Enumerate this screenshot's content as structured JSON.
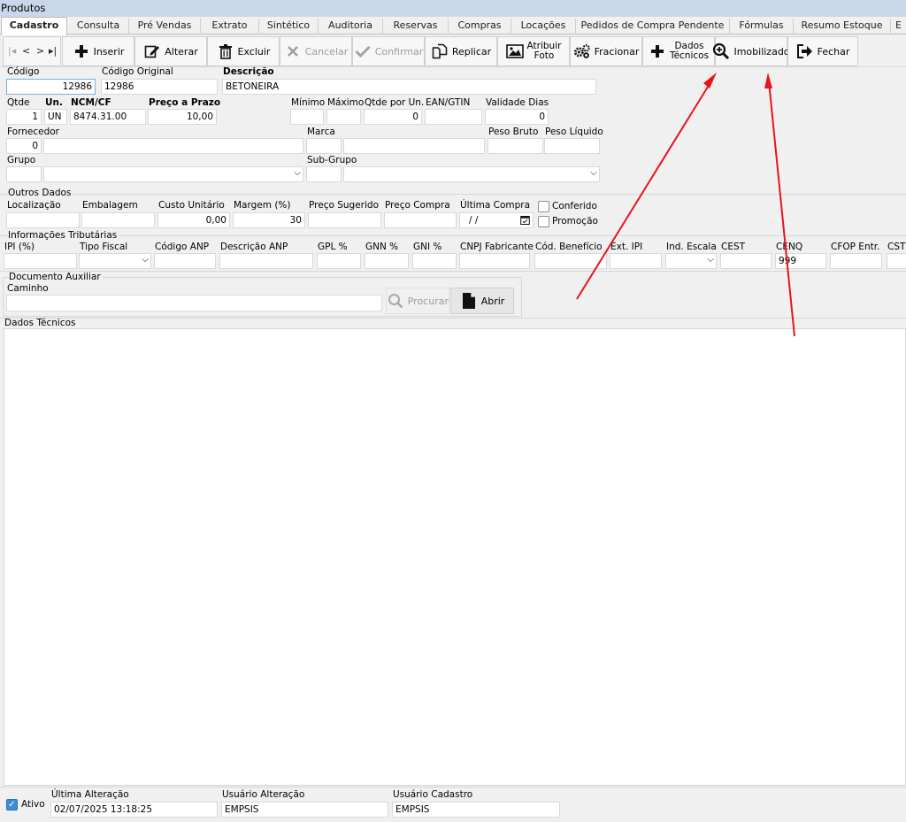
{
  "window": {
    "title": "Produtos"
  },
  "tabs": [
    "Cadastro",
    "Consulta",
    "Pré Vendas",
    "Extrato",
    "Sintético",
    "Auditoria",
    "Reservas",
    "Compras",
    "Locações",
    "Pedidos de Compra Pendente",
    "Fórmulas",
    "Resumo Estoque",
    "E"
  ],
  "toolbar": {
    "insert": "Inserir",
    "alter": "Alterar",
    "delete": "Excluir",
    "cancel": "Cancelar",
    "confirm": "Confirmar",
    "replicate": "Replicar",
    "photo_l1": "Atribuir",
    "photo_l2": "Foto",
    "split": "Fracionar",
    "tech_l1": "Dados",
    "tech_l2": "Técnicos",
    "fixed_asset": "Imobilizado",
    "close": "Fechar"
  },
  "form": {
    "codigo": {
      "label": "Código",
      "value": "12986"
    },
    "codigo_original": {
      "label": "Código Original",
      "value": "12986"
    },
    "descricao": {
      "label": "Descrição",
      "value": "BETONEIRA"
    },
    "qtde": {
      "label": "Qtde",
      "value": "1"
    },
    "un": {
      "label": "Un.",
      "value": "UN"
    },
    "ncm": {
      "label": "NCM/CF",
      "value": "8474.31.00"
    },
    "preco_prazo": {
      "label": "Preço a Prazo",
      "value": "10,00"
    },
    "minimo": {
      "label": "Mínimo",
      "value": ""
    },
    "maximo": {
      "label": "Máximo",
      "value": ""
    },
    "qtde_un": {
      "label": "Qtde por Un.",
      "value": "0"
    },
    "ean": {
      "label": "EAN/GTIN",
      "value": ""
    },
    "validade": {
      "label": "Validade Dias",
      "value": "0"
    },
    "fornecedor": {
      "label": "Fornecedor",
      "value": "0"
    },
    "marca": {
      "label": "Marca"
    },
    "peso_bruto": {
      "label": "Peso Bruto"
    },
    "peso_liquido": {
      "label": "Peso Líquido"
    },
    "grupo": {
      "label": "Grupo"
    },
    "subgrupo": {
      "label": "Sub-Grupo"
    }
  },
  "outros": {
    "title": "Outros Dados",
    "localizacao": "Localização",
    "embalagem": "Embalagem",
    "custo": {
      "label": "Custo Unitário",
      "value": "0,00"
    },
    "margem": {
      "label": "Margem (%)",
      "value": "30"
    },
    "preco_sugerido": "Preço Sugerido",
    "preco_compra": "Preço Compra",
    "ultima_compra": {
      "label": "Última Compra",
      "value": "/ /"
    },
    "conferido": "Conferido",
    "promocao": "Promoção"
  },
  "tributarias": {
    "title": "Informações Tributárias",
    "ipi": "IPI (%)",
    "tipo_fiscal": "Tipo Fiscal",
    "codigo_anp": "Código ANP",
    "descricao_anp": "Descrição ANP",
    "gpl": "GPL %",
    "gnn": "GNN %",
    "gni": "GNI %",
    "cnpj_fab": "CNPJ Fabricante",
    "cod_beneficio": "Cód. Benefício",
    "ext_ipi": "Ext. IPI",
    "ind_escala": "Ind. Escala",
    "cest": "CEST",
    "cenq": {
      "label": "CENQ",
      "value": "999"
    },
    "cfop": "CFOP Entr.",
    "cst": "CST"
  },
  "documento": {
    "title": "Documento Auxiliar",
    "caminho": "Caminho",
    "procurar": "Procurar",
    "abrir": "Abrir"
  },
  "dados_tecnicos": {
    "title": "Dados Técnicos"
  },
  "footer": {
    "ativo": "Ativo",
    "ultima_alteracao": {
      "label": "Última Alteração",
      "value": "02/07/2025 13:18:25"
    },
    "usuario_alteracao": {
      "label": "Usuário Alteração",
      "value": "EMPSIS"
    },
    "usuario_cadastro": {
      "label": "Usuário Cadastro",
      "value": "EMPSIS"
    }
  },
  "colors": {
    "annotation_arrow": "#e8141c",
    "titlebar": "#c8d8ea",
    "focus_border": "#7aaed8",
    "check_blue": "#3b8fd6"
  }
}
